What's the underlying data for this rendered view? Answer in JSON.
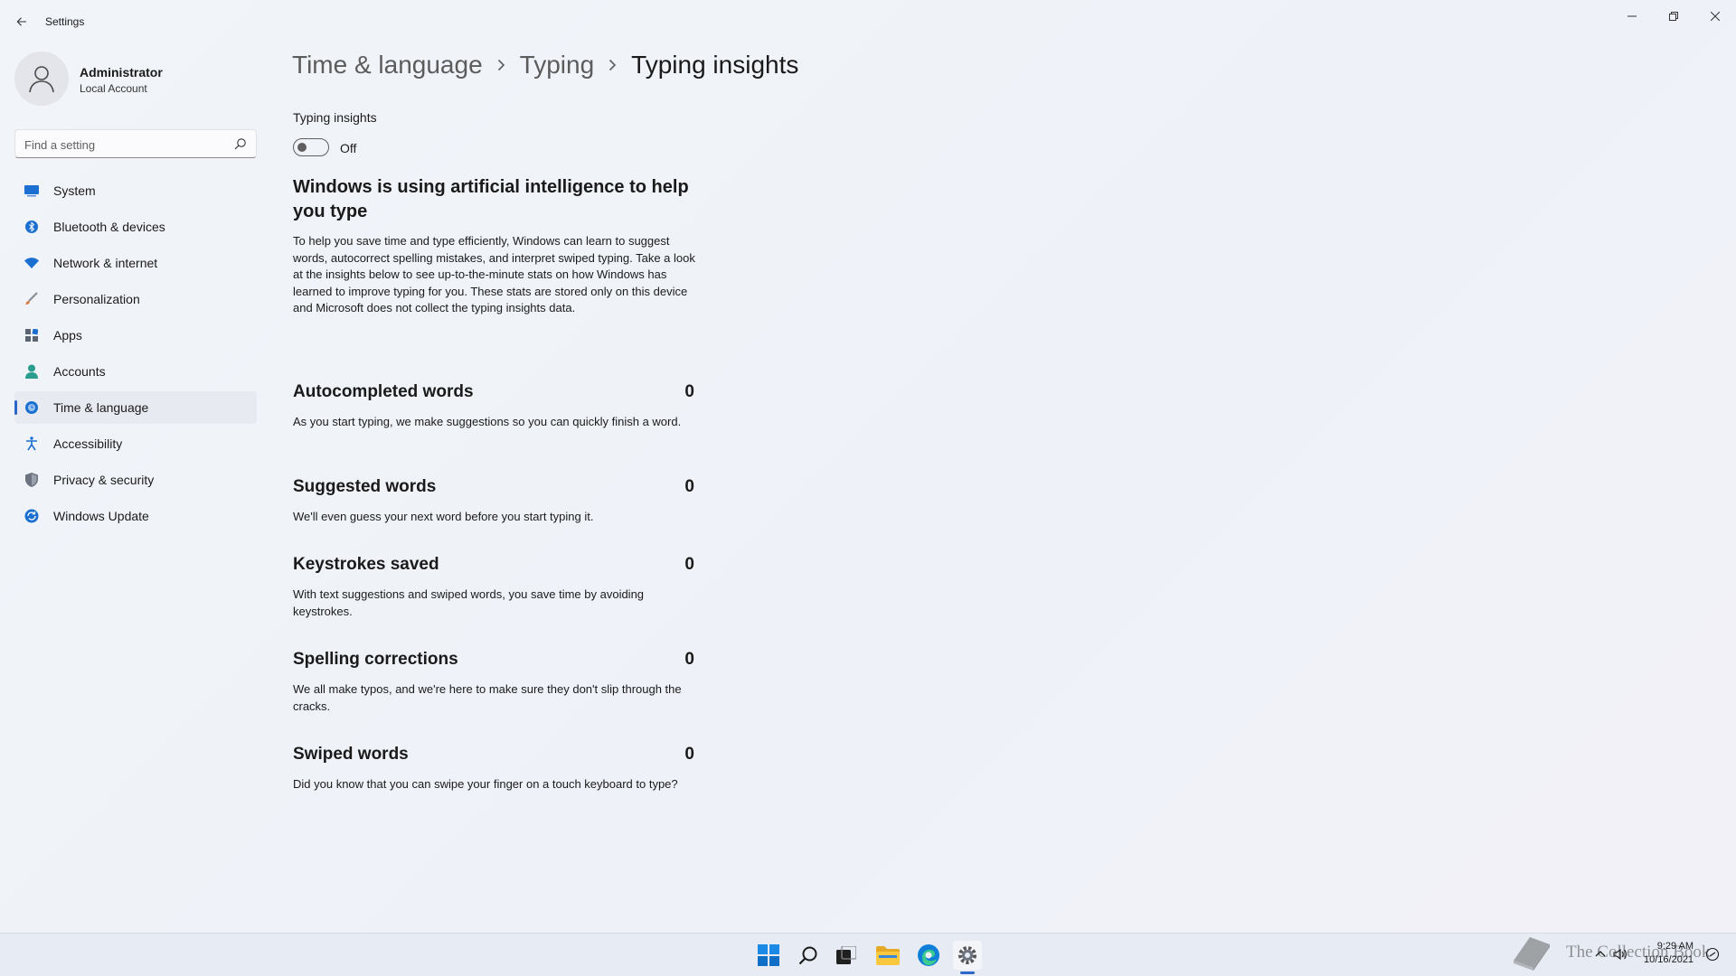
{
  "window": {
    "title": "Settings",
    "back_icon": "back-arrow-icon",
    "controls": [
      "minimize-icon",
      "restore-icon",
      "close-icon"
    ]
  },
  "profile": {
    "name": "Administrator",
    "account_type": "Local Account"
  },
  "search": {
    "placeholder": "Find a setting"
  },
  "sidebar": {
    "items": [
      {
        "label": "System",
        "icon": "system-icon",
        "color": "#1b6fd1"
      },
      {
        "label": "Bluetooth & devices",
        "icon": "bluetooth-icon",
        "color": "#1b6fd1"
      },
      {
        "label": "Network & internet",
        "icon": "wifi-icon",
        "color": "#1b6fd1"
      },
      {
        "label": "Personalization",
        "icon": "brush-icon",
        "color": "#d9783a"
      },
      {
        "label": "Apps",
        "icon": "apps-icon",
        "color": "#5a6472"
      },
      {
        "label": "Accounts",
        "icon": "account-icon",
        "color": "#2a9d8f"
      },
      {
        "label": "Time & language",
        "icon": "globe-clock-icon",
        "color": "#1b6fd1",
        "active": true
      },
      {
        "label": "Accessibility",
        "icon": "accessibility-icon",
        "color": "#1b6fd1"
      },
      {
        "label": "Privacy & security",
        "icon": "shield-icon",
        "color": "#6b7380"
      },
      {
        "label": "Windows Update",
        "icon": "update-icon",
        "color": "#1b6fd1"
      }
    ]
  },
  "breadcrumb": {
    "items": [
      "Time & language",
      "Typing"
    ],
    "current": "Typing insights"
  },
  "typing_insights": {
    "label": "Typing insights",
    "state": "Off",
    "enabled": false
  },
  "intro": {
    "heading": "Windows is using artificial intelligence to help you type",
    "body": "To help you save time and type efficiently, Windows can learn to suggest words, autocorrect spelling mistakes, and interpret swiped typing. Take a look at the insights below to see up-to-the-minute stats on how Windows has learned to improve typing for you. These stats are stored only on this device and Microsoft does not collect the typing insights data."
  },
  "stats": [
    {
      "title": "Autocompleted words",
      "value": "0",
      "description": "As you start typing, we make suggestions so you can quickly finish a word."
    },
    {
      "title": "Suggested words",
      "value": "0",
      "description": "We'll even guess your next word before you start typing it."
    },
    {
      "title": "Keystrokes saved",
      "value": "0",
      "description": "With text suggestions and swiped words, you save time by avoiding keystrokes."
    },
    {
      "title": "Spelling corrections",
      "value": "0",
      "description": "We all make typos, and we're here to make sure they don't slip through the cracks."
    },
    {
      "title": "Swiped words",
      "value": "0",
      "description": "Did you know that you can swipe your finger on a touch keyboard to type?"
    }
  ],
  "taskbar": {
    "apps": [
      "start-icon",
      "search-icon",
      "task-view-icon",
      "file-explorer-icon",
      "edge-icon",
      "settings-icon"
    ],
    "time": "9:29 AM",
    "date": "10/16/2021",
    "watermark": "The Collection Book"
  },
  "colors": {
    "accent": "#2b66c8",
    "background": "#eef2f8",
    "active_nav": "#e7eaf0"
  }
}
